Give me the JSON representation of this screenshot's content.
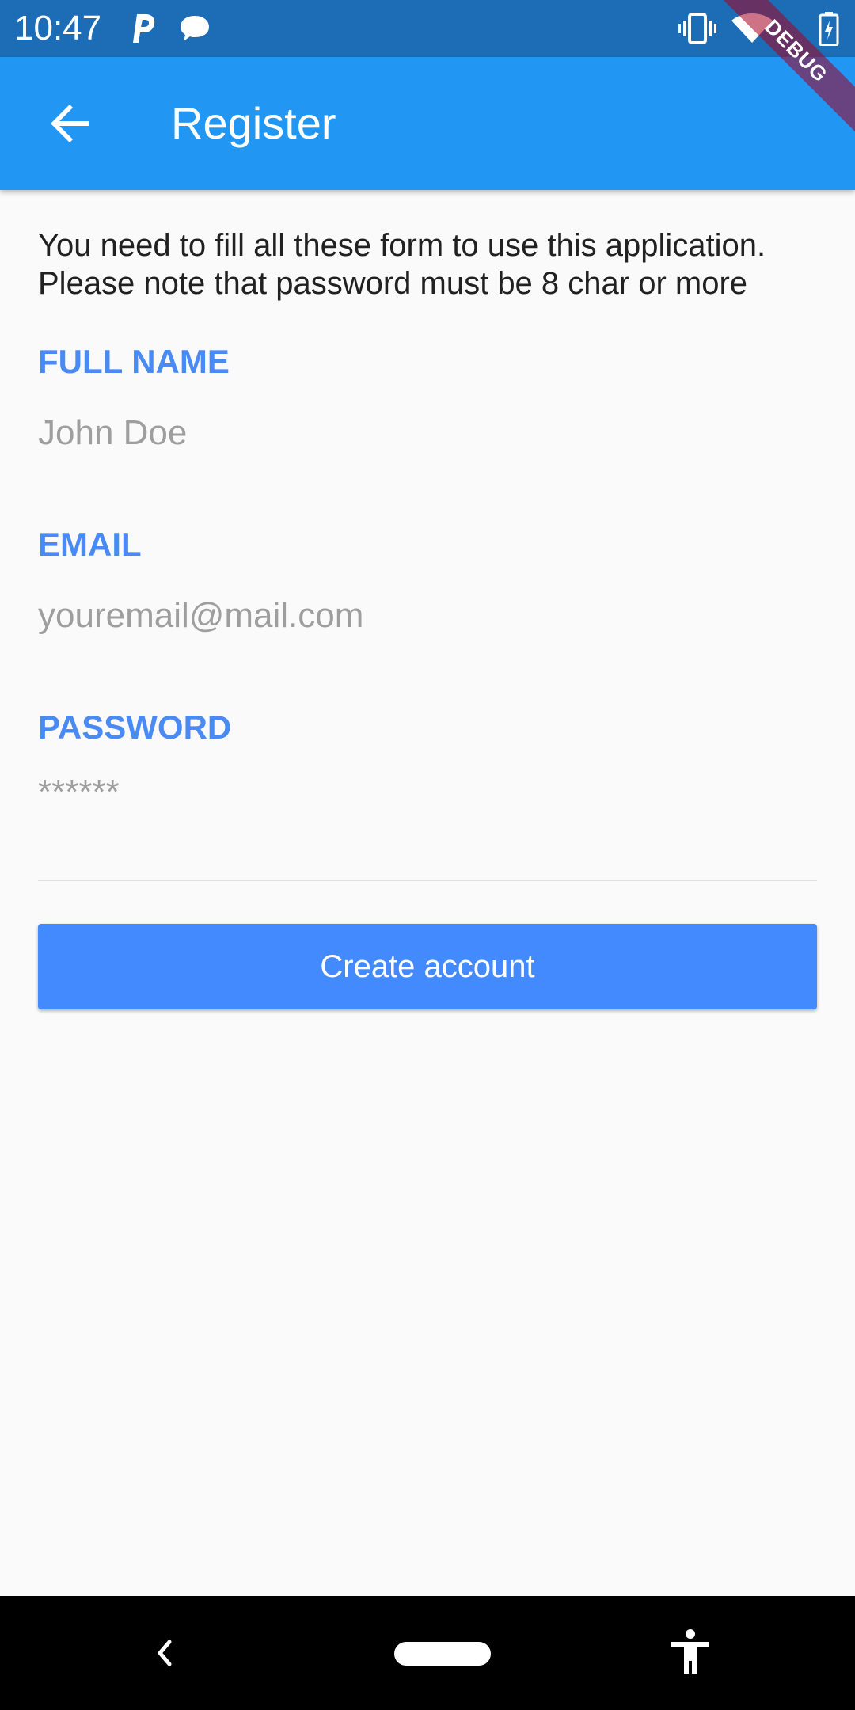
{
  "status_bar": {
    "time": "10:47",
    "icons": [
      "parking-notification-icon",
      "chat-bubble-icon",
      "vibrate-icon",
      "wifi-icon",
      "battery-charging-icon"
    ]
  },
  "debug_banner": "DEBUG",
  "app_bar": {
    "title": "Register",
    "back_icon": "arrow-back-icon",
    "color": "#2196f3"
  },
  "intro": {
    "text": "You need to fill all these form to use this application. Please note that password must be 8 char or more"
  },
  "form": {
    "full_name": {
      "label": "FULL NAME",
      "placeholder": "John Doe"
    },
    "email": {
      "label": "EMAIL",
      "placeholder": "youremail@mail.com"
    },
    "password": {
      "label": "PASSWORD",
      "placeholder": "******"
    }
  },
  "actions": {
    "create_account": "Create account",
    "button_color": "#448aff"
  },
  "nav_bar": {
    "icons": [
      "back-nav-icon",
      "home-pill-icon",
      "accessibility-icon"
    ]
  }
}
